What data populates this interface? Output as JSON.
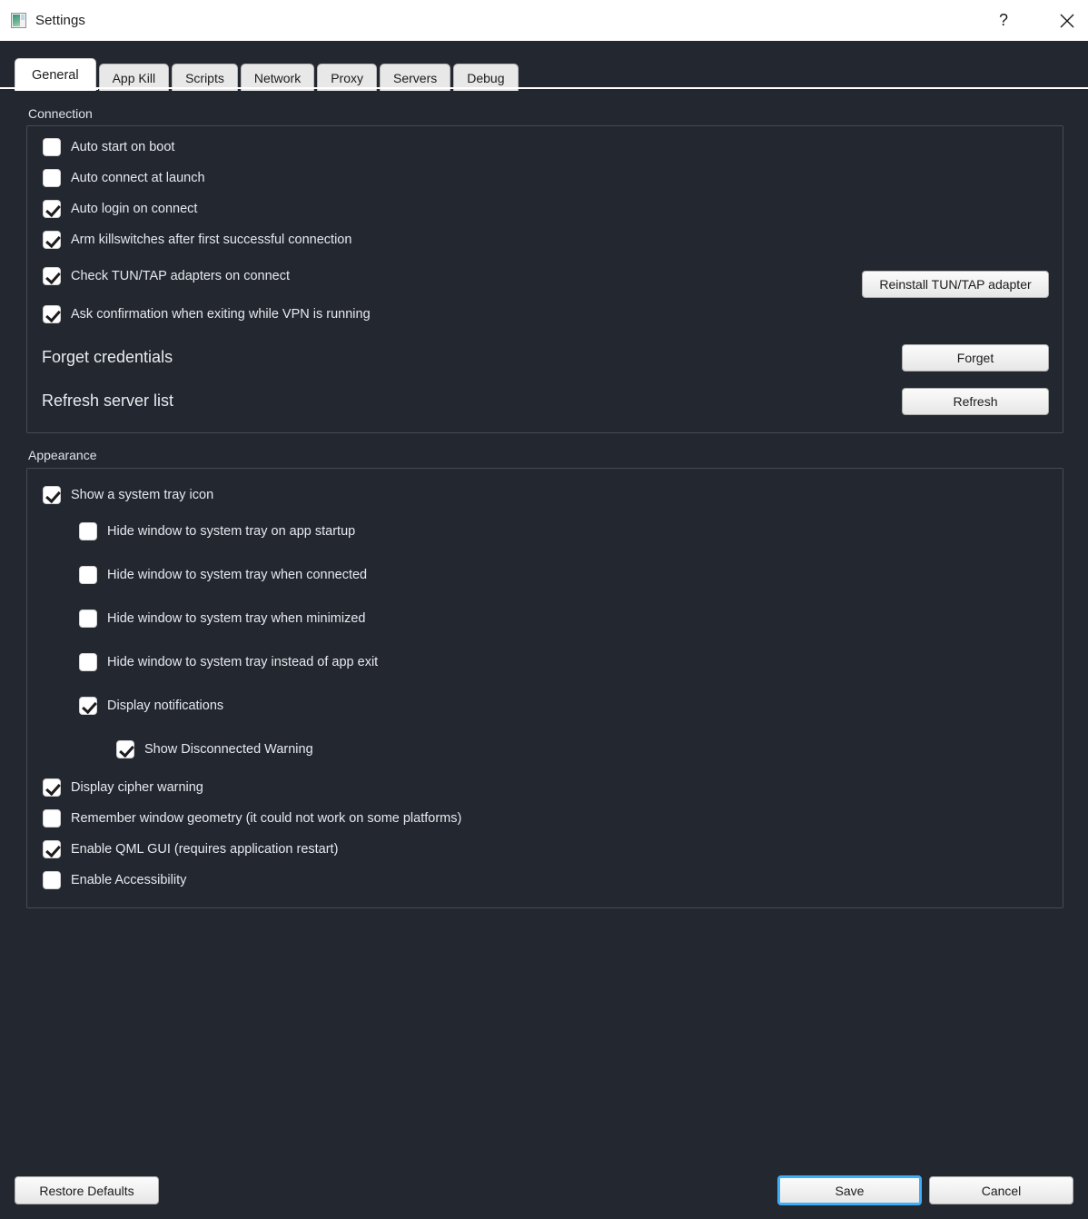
{
  "window": {
    "title": "Settings",
    "icon": "app-image-icon",
    "help_label": "?",
    "close_label": "✕"
  },
  "tabs": [
    {
      "label": "General",
      "active": true
    },
    {
      "label": "App Kill",
      "active": false
    },
    {
      "label": "Scripts",
      "active": false
    },
    {
      "label": "Network",
      "active": false
    },
    {
      "label": "Proxy",
      "active": false
    },
    {
      "label": "Servers",
      "active": false
    },
    {
      "label": "Debug",
      "active": false
    }
  ],
  "connection": {
    "section_label": "Connection",
    "checkboxes": [
      {
        "label": "Auto start on boot",
        "checked": false
      },
      {
        "label": "Auto connect at launch",
        "checked": false
      },
      {
        "label": "Auto login on connect",
        "checked": true
      },
      {
        "label": "Arm killswitches after first successful connection",
        "checked": true
      },
      {
        "label": "Check TUN/TAP adapters on connect",
        "checked": true
      },
      {
        "label": "Ask confirmation when exiting while VPN is running",
        "checked": true
      }
    ],
    "reinstall_button": "Reinstall TUN/TAP adapter",
    "forget_credentials_label": "Forget credentials",
    "forget_button": "Forget",
    "refresh_server_list_label": "Refresh server list",
    "refresh_button": "Refresh"
  },
  "appearance": {
    "section_label": "Appearance",
    "checkboxes": [
      {
        "label": "Show a system tray icon",
        "checked": true,
        "indent": 0
      },
      {
        "label": "Hide window to system tray on app startup",
        "checked": false,
        "indent": 1
      },
      {
        "label": "Hide window to system tray when connected",
        "checked": false,
        "indent": 1
      },
      {
        "label": "Hide window to system tray when minimized",
        "checked": false,
        "indent": 1
      },
      {
        "label": "Hide window to system tray instead of app exit",
        "checked": false,
        "indent": 1
      },
      {
        "label": "Display notifications",
        "checked": true,
        "indent": 1
      },
      {
        "label": "Show Disconnected Warning",
        "checked": true,
        "indent": 2
      },
      {
        "label": "Display cipher warning",
        "checked": true,
        "indent": 0
      },
      {
        "label": "Remember window geometry (it could not work on some platforms)",
        "checked": false,
        "indent": 0
      },
      {
        "label": "Enable QML GUI (requires application restart)",
        "checked": true,
        "indent": 0
      },
      {
        "label": "Enable Accessibility",
        "checked": false,
        "indent": 0
      }
    ]
  },
  "footer": {
    "restore_defaults": "Restore Defaults",
    "save": "Save",
    "cancel": "Cancel"
  },
  "colors": {
    "background": "#23272f",
    "titlebar": "#ffffff",
    "accent_focus": "#3daefa",
    "groupbox_border": "#464b56",
    "text": "#e6e9ef"
  }
}
